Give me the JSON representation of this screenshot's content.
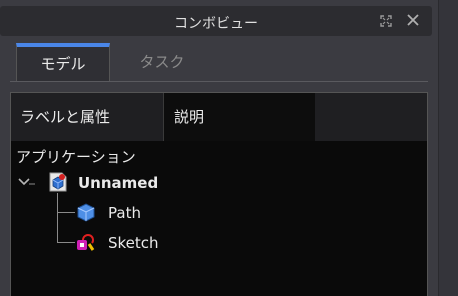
{
  "window": {
    "title": "コンボビュー"
  },
  "tabs": [
    {
      "label": "モデル",
      "active": true
    },
    {
      "label": "タスク",
      "active": false
    }
  ],
  "tree": {
    "columns": [
      "ラベルと属性",
      "説明",
      ""
    ],
    "group_label": "アプリケーション",
    "items": [
      {
        "label": "Unnamed",
        "icon": "document-icon",
        "expanded": true
      },
      {
        "label": "Path",
        "icon": "path-solid-icon"
      },
      {
        "label": "Sketch",
        "icon": "sketch-icon"
      }
    ]
  },
  "colors": {
    "accent": "#4a86e8",
    "tree_bg": "#0a0a0a",
    "panel_bg": "#3b3b41"
  }
}
